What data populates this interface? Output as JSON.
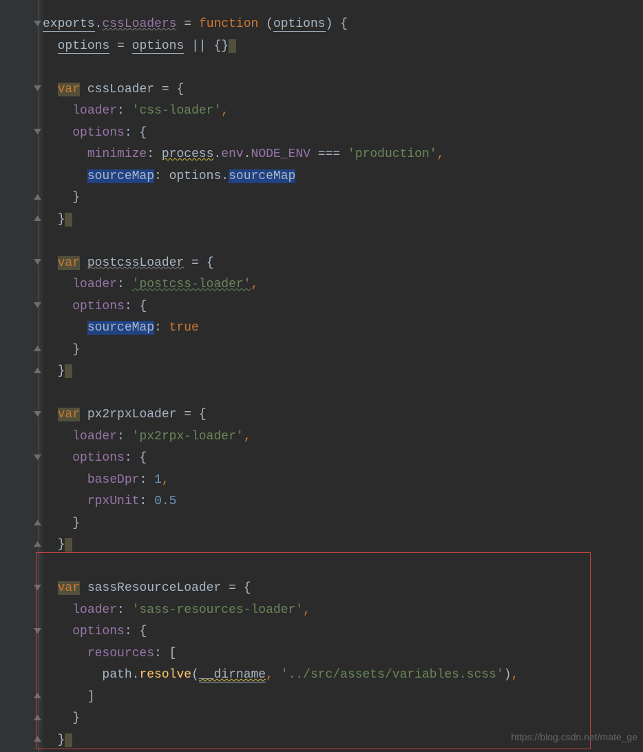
{
  "code": {
    "l1_exports": "exports",
    "l1_cssLoaders": "cssLoaders",
    "l1_function": "function",
    "l1_options": "options",
    "l2_options1": "options",
    "l2_options2": "options",
    "var": "var",
    "cssLoader": "cssLoader",
    "loader": "loader",
    "cssLoaderStr": "'css-loader'",
    "options_key": "options",
    "minimize": "minimize",
    "process": "process",
    "env": "env",
    "NODE_ENV": "NODE_ENV",
    "eqeqeq": "===",
    "production": "'production'",
    "sourceMap": "sourceMap",
    "postcssLoader": "postcssLoader",
    "postcssLoaderStr": "'postcss-loader'",
    "true": "true",
    "px2rpxLoader": "px2rpxLoader",
    "px2rpxLoaderStr": "'px2rpx-loader'",
    "baseDpr": "baseDpr",
    "one": "1",
    "rpxUnit": "rpxUnit",
    "halfpoint": "0.5",
    "sassResourceLoader": "sassResourceLoader",
    "sassResourcesLoaderStr": "'sass-resources-loader'",
    "resources": "resources",
    "path": "path",
    "resolve": "resolve",
    "dirname": "__dirname",
    "variablesPath": "'../src/assets/variables.scss'"
  },
  "watermark": "https://blog.csdn.net/mate_ge"
}
